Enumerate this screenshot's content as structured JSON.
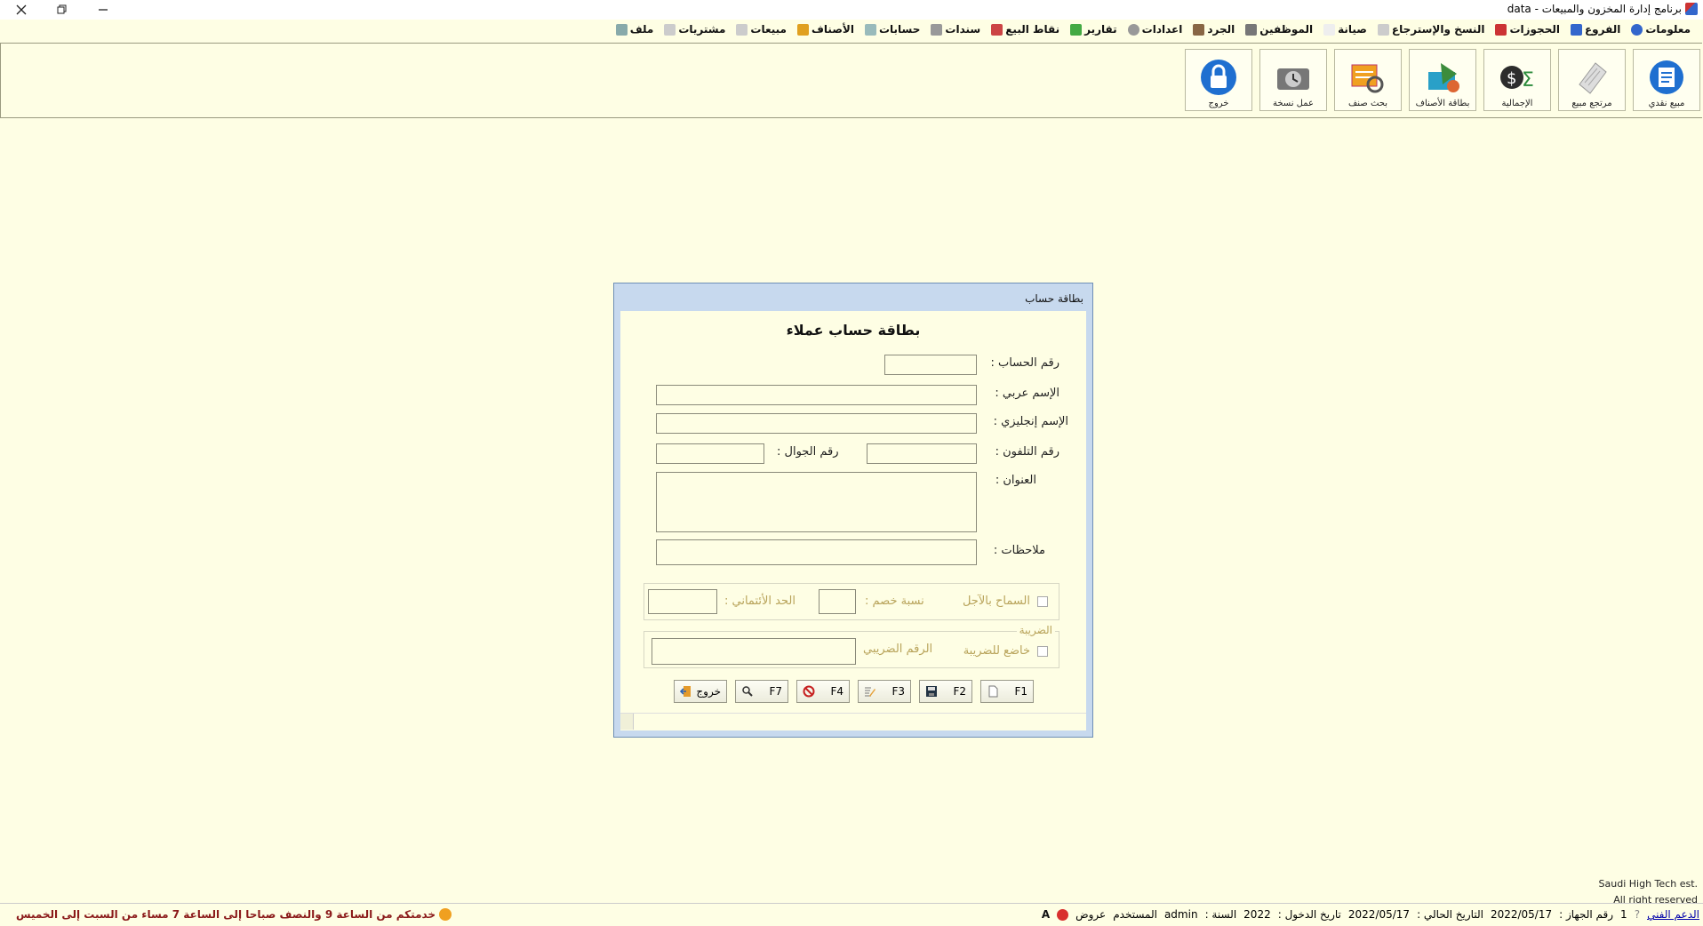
{
  "window": {
    "title": "برنامج إدارة المخزون والمبيعات  -  data"
  },
  "menu": [
    {
      "label": "ملف",
      "icon": "file-icon"
    },
    {
      "label": "مشتريات",
      "icon": "document-icon"
    },
    {
      "label": "مبيعات",
      "icon": "document-icon"
    },
    {
      "label": "الأصناف",
      "icon": "lock-bag-icon"
    },
    {
      "label": "حسابات",
      "icon": "bottle-icon"
    },
    {
      "label": "سندات",
      "icon": "cards-icon"
    },
    {
      "label": "نقاط البيع",
      "icon": "printer-icon"
    },
    {
      "label": "تقارير",
      "icon": "chart-icon"
    },
    {
      "label": "اعدادات",
      "icon": "globe-icon"
    },
    {
      "label": "الجرد",
      "icon": "clipboard-icon"
    },
    {
      "label": "الموظفين",
      "icon": "person-icon"
    },
    {
      "label": "صيانة",
      "icon": "tools-icon"
    },
    {
      "label": "النسخ والإسترجاع",
      "icon": "backup-icon"
    },
    {
      "label": "الحجوزات",
      "icon": "calendar-icon"
    },
    {
      "label": "الفروع",
      "icon": "store-icon"
    },
    {
      "label": "معلومات",
      "icon": "info-icon"
    }
  ],
  "toolbar": [
    {
      "label": "مبيع نقدي",
      "icon": "cash-sale-icon"
    },
    {
      "label": "مرتجع مبيع",
      "icon": "sales-return-icon"
    },
    {
      "label": "الإجمالية",
      "icon": "totals-icon"
    },
    {
      "label": "بطاقة الأصناف",
      "icon": "item-card-icon"
    },
    {
      "label": "بحث صنف",
      "icon": "item-search-icon"
    },
    {
      "label": "عمل نسخة",
      "icon": "backup-icon"
    },
    {
      "label": "خروج",
      "icon": "lock-icon"
    }
  ],
  "dialog": {
    "title": "بطاقة حساب",
    "heading": "بطاقة حساب عملاء",
    "fields": {
      "account_number": {
        "label": "رقم الحساب :",
        "value": ""
      },
      "arabic_name": {
        "label": "الإسم عربي :",
        "value": ""
      },
      "english_name": {
        "label": "الإسم إنجليزي :",
        "value": ""
      },
      "phone": {
        "label": "رقم التلفون :",
        "value": ""
      },
      "mobile": {
        "label": "رقم الجوال :",
        "value": ""
      },
      "address": {
        "label": "العنوان :",
        "value": ""
      },
      "notes": {
        "label": "ملاحظات :",
        "value": ""
      }
    },
    "credit": {
      "allow_credit_label": "السماح بالآجل",
      "allow_credit_checked": false,
      "discount_label": "نسبة خصم :",
      "discount_value": "",
      "credit_limit_label": "الحد الأئتماني :",
      "credit_limit_value": ""
    },
    "tax": {
      "legend": "الضريبة",
      "taxable_label": "خاضع للضريبة",
      "taxable_checked": false,
      "tax_number_label": "الرقم الضريبي",
      "tax_number_value": ""
    },
    "buttons": {
      "f1": "F1",
      "f2": "F2",
      "f3": "F3",
      "f4": "F4",
      "f7": "F7",
      "exit": "خروج"
    }
  },
  "copyright": {
    "line1": "Saudi High Tech est.",
    "line2": "All right reserved"
  },
  "status": {
    "offers": "عروض",
    "user_label": "المستخدم",
    "user": "admin",
    "year_label": "السنة :",
    "year": "2022",
    "login_date_label": "تاريخ الدخول :",
    "login_date": "2022/05/17",
    "current_date_label": "التاريخ الحالي :",
    "current_date": "2022/05/17",
    "device_label": "رقم الجهاز :",
    "device": "1",
    "support": "الدعم الفني",
    "hours": "خدمتكم من الساعة 9 والنصف صباحا إلى الساعة 7 مساء من السبت إلى الخميس"
  },
  "colors": {
    "background": "#fefee4",
    "dialog_frame": "#c7d9ee",
    "group_label": "#b8a35a",
    "status_hours": "#8b1a1a",
    "support_link": "#0000aa"
  }
}
